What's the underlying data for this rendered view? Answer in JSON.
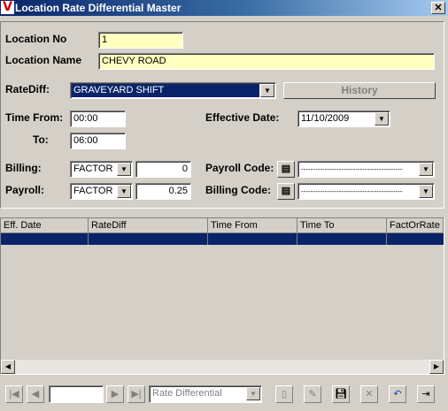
{
  "window": {
    "title": "Location Rate Differential Master",
    "logo_letter": "V",
    "close_glyph": "✕"
  },
  "form": {
    "location_no_label": "Location No",
    "location_no_value": "1",
    "location_name_label": "Location Name",
    "location_name_value": "CHEVY ROAD",
    "ratediff_label": "RateDiff:",
    "ratediff_value": "GRAVEYARD SHIFT",
    "history_label": "History",
    "time_from_label": "Time From:",
    "time_from_value": "00:00",
    "to_label": "To:",
    "to_value": "06:00",
    "effective_date_label": "Effective Date:",
    "effective_date_value": "11/10/2009",
    "billing_label": "Billing:",
    "billing_type": "FACTOR",
    "billing_value": "0",
    "payroll_label": "Payroll:",
    "payroll_type": "FACTOR",
    "payroll_value": "0.25",
    "payroll_code_label": "Payroll Code:",
    "payroll_code_value": "-------------------------------------------",
    "billing_code_label": "Billing Code:",
    "billing_code_value": "-------------------------------------------"
  },
  "grid": {
    "columns": [
      "Eff. Date",
      "RateDiff",
      "Time From",
      "Time To",
      "FactOrRate"
    ]
  },
  "navigator": {
    "record_value": "",
    "combo_value": "Rate Differential"
  },
  "icons": {
    "first": "first-record-icon",
    "prev": "prev-record-icon",
    "next": "next-record-icon",
    "last": "last-record-icon"
  }
}
